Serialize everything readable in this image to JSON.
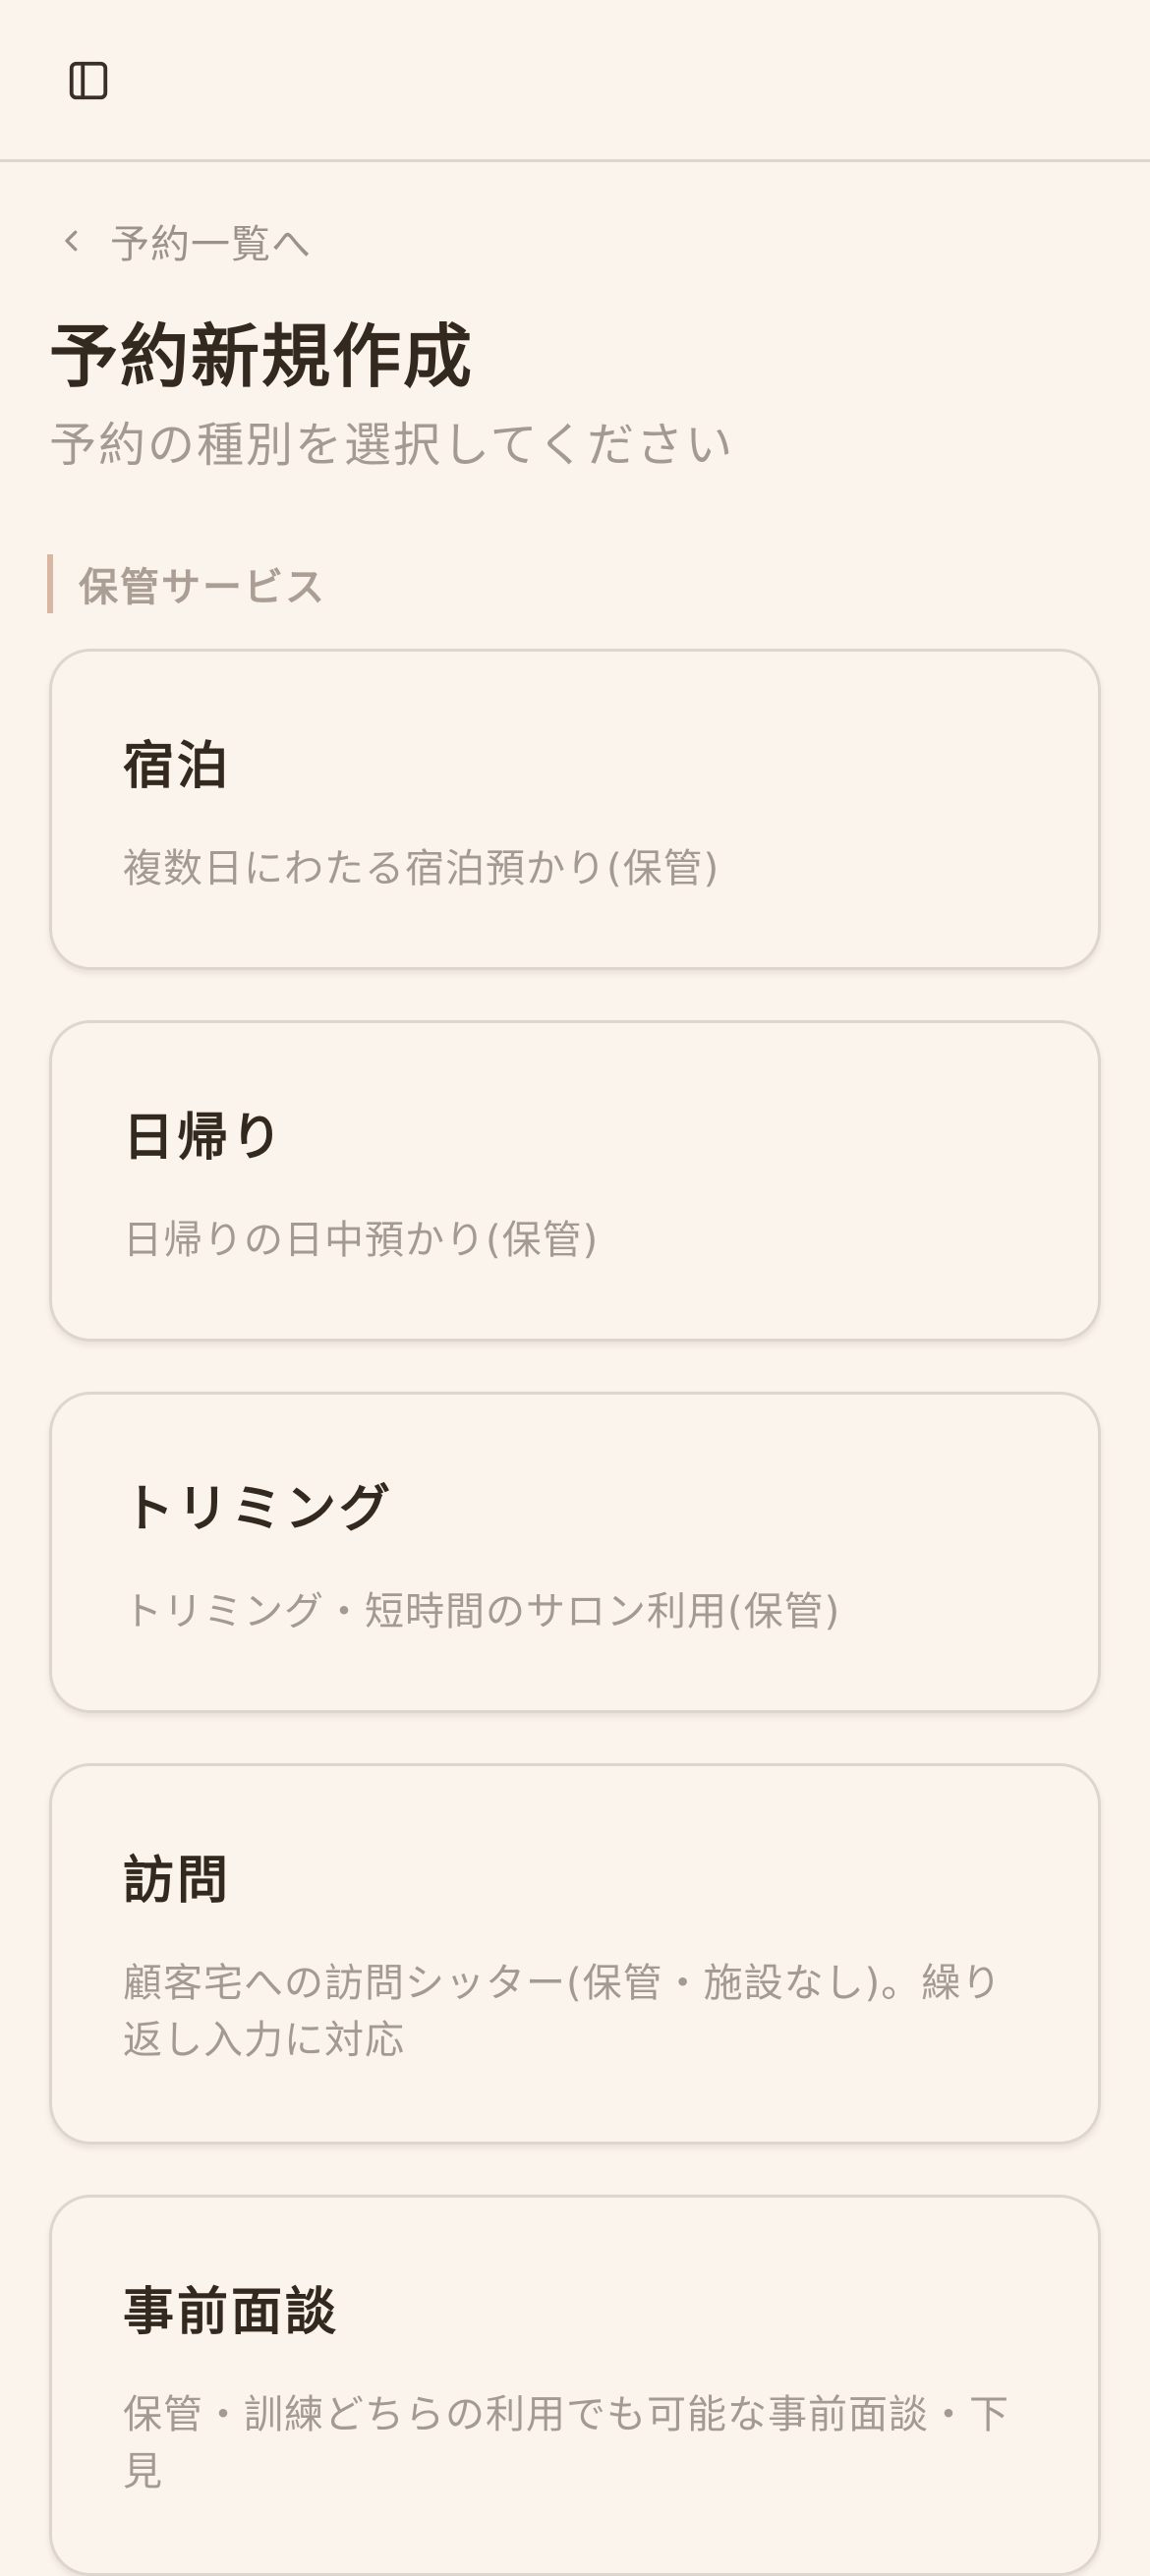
{
  "header": {
    "sidebar_toggle_icon": "sidebar-panel-icon"
  },
  "breadcrumb": {
    "back_icon": "chevron-left-icon",
    "back_label": "予約一覧へ"
  },
  "page": {
    "title": "予約新規作成",
    "subtitle": "予約の種別を選択してください"
  },
  "section": {
    "heading": "保管サービス",
    "accent_color": "#d9b6a2"
  },
  "cards": [
    {
      "title": "宿泊",
      "description": "複数日にわたる宿泊預かり(保管)"
    },
    {
      "title": "日帰り",
      "description": "日帰りの日中預かり(保管)"
    },
    {
      "title": "トリミング",
      "description": "トリミング・短時間のサロン利用(保管)"
    },
    {
      "title": "訪問",
      "description": "顧客宅への訪問シッター(保管・施設なし)。繰り返し入力に対応"
    },
    {
      "title": "事前面談",
      "description": "保管・訓練どちらの利用でも可能な事前面談・下見"
    }
  ],
  "colors": {
    "background": "#faf4ec",
    "text_primary": "#33291f",
    "text_muted": "#a39a92",
    "border": "#ddd6cf"
  }
}
